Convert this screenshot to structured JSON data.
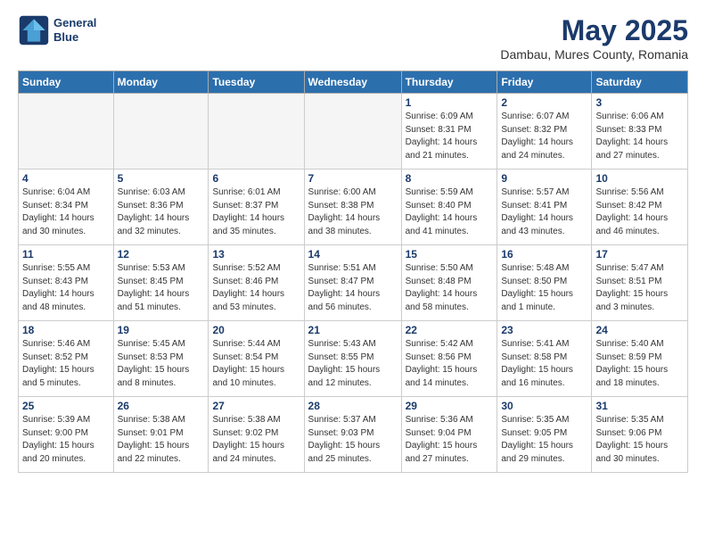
{
  "header": {
    "logo_line1": "General",
    "logo_line2": "Blue",
    "month": "May 2025",
    "location": "Dambau, Mures County, Romania"
  },
  "days_of_week": [
    "Sunday",
    "Monday",
    "Tuesday",
    "Wednesday",
    "Thursday",
    "Friday",
    "Saturday"
  ],
  "weeks": [
    [
      {
        "day": "",
        "info": ""
      },
      {
        "day": "",
        "info": ""
      },
      {
        "day": "",
        "info": ""
      },
      {
        "day": "",
        "info": ""
      },
      {
        "day": "1",
        "info": "Sunrise: 6:09 AM\nSunset: 8:31 PM\nDaylight: 14 hours\nand 21 minutes."
      },
      {
        "day": "2",
        "info": "Sunrise: 6:07 AM\nSunset: 8:32 PM\nDaylight: 14 hours\nand 24 minutes."
      },
      {
        "day": "3",
        "info": "Sunrise: 6:06 AM\nSunset: 8:33 PM\nDaylight: 14 hours\nand 27 minutes."
      }
    ],
    [
      {
        "day": "4",
        "info": "Sunrise: 6:04 AM\nSunset: 8:34 PM\nDaylight: 14 hours\nand 30 minutes."
      },
      {
        "day": "5",
        "info": "Sunrise: 6:03 AM\nSunset: 8:36 PM\nDaylight: 14 hours\nand 32 minutes."
      },
      {
        "day": "6",
        "info": "Sunrise: 6:01 AM\nSunset: 8:37 PM\nDaylight: 14 hours\nand 35 minutes."
      },
      {
        "day": "7",
        "info": "Sunrise: 6:00 AM\nSunset: 8:38 PM\nDaylight: 14 hours\nand 38 minutes."
      },
      {
        "day": "8",
        "info": "Sunrise: 5:59 AM\nSunset: 8:40 PM\nDaylight: 14 hours\nand 41 minutes."
      },
      {
        "day": "9",
        "info": "Sunrise: 5:57 AM\nSunset: 8:41 PM\nDaylight: 14 hours\nand 43 minutes."
      },
      {
        "day": "10",
        "info": "Sunrise: 5:56 AM\nSunset: 8:42 PM\nDaylight: 14 hours\nand 46 minutes."
      }
    ],
    [
      {
        "day": "11",
        "info": "Sunrise: 5:55 AM\nSunset: 8:43 PM\nDaylight: 14 hours\nand 48 minutes."
      },
      {
        "day": "12",
        "info": "Sunrise: 5:53 AM\nSunset: 8:45 PM\nDaylight: 14 hours\nand 51 minutes."
      },
      {
        "day": "13",
        "info": "Sunrise: 5:52 AM\nSunset: 8:46 PM\nDaylight: 14 hours\nand 53 minutes."
      },
      {
        "day": "14",
        "info": "Sunrise: 5:51 AM\nSunset: 8:47 PM\nDaylight: 14 hours\nand 56 minutes."
      },
      {
        "day": "15",
        "info": "Sunrise: 5:50 AM\nSunset: 8:48 PM\nDaylight: 14 hours\nand 58 minutes."
      },
      {
        "day": "16",
        "info": "Sunrise: 5:48 AM\nSunset: 8:50 PM\nDaylight: 15 hours\nand 1 minute."
      },
      {
        "day": "17",
        "info": "Sunrise: 5:47 AM\nSunset: 8:51 PM\nDaylight: 15 hours\nand 3 minutes."
      }
    ],
    [
      {
        "day": "18",
        "info": "Sunrise: 5:46 AM\nSunset: 8:52 PM\nDaylight: 15 hours\nand 5 minutes."
      },
      {
        "day": "19",
        "info": "Sunrise: 5:45 AM\nSunset: 8:53 PM\nDaylight: 15 hours\nand 8 minutes."
      },
      {
        "day": "20",
        "info": "Sunrise: 5:44 AM\nSunset: 8:54 PM\nDaylight: 15 hours\nand 10 minutes."
      },
      {
        "day": "21",
        "info": "Sunrise: 5:43 AM\nSunset: 8:55 PM\nDaylight: 15 hours\nand 12 minutes."
      },
      {
        "day": "22",
        "info": "Sunrise: 5:42 AM\nSunset: 8:56 PM\nDaylight: 15 hours\nand 14 minutes."
      },
      {
        "day": "23",
        "info": "Sunrise: 5:41 AM\nSunset: 8:58 PM\nDaylight: 15 hours\nand 16 minutes."
      },
      {
        "day": "24",
        "info": "Sunrise: 5:40 AM\nSunset: 8:59 PM\nDaylight: 15 hours\nand 18 minutes."
      }
    ],
    [
      {
        "day": "25",
        "info": "Sunrise: 5:39 AM\nSunset: 9:00 PM\nDaylight: 15 hours\nand 20 minutes."
      },
      {
        "day": "26",
        "info": "Sunrise: 5:38 AM\nSunset: 9:01 PM\nDaylight: 15 hours\nand 22 minutes."
      },
      {
        "day": "27",
        "info": "Sunrise: 5:38 AM\nSunset: 9:02 PM\nDaylight: 15 hours\nand 24 minutes."
      },
      {
        "day": "28",
        "info": "Sunrise: 5:37 AM\nSunset: 9:03 PM\nDaylight: 15 hours\nand 25 minutes."
      },
      {
        "day": "29",
        "info": "Sunrise: 5:36 AM\nSunset: 9:04 PM\nDaylight: 15 hours\nand 27 minutes."
      },
      {
        "day": "30",
        "info": "Sunrise: 5:35 AM\nSunset: 9:05 PM\nDaylight: 15 hours\nand 29 minutes."
      },
      {
        "day": "31",
        "info": "Sunrise: 5:35 AM\nSunset: 9:06 PM\nDaylight: 15 hours\nand 30 minutes."
      }
    ]
  ]
}
